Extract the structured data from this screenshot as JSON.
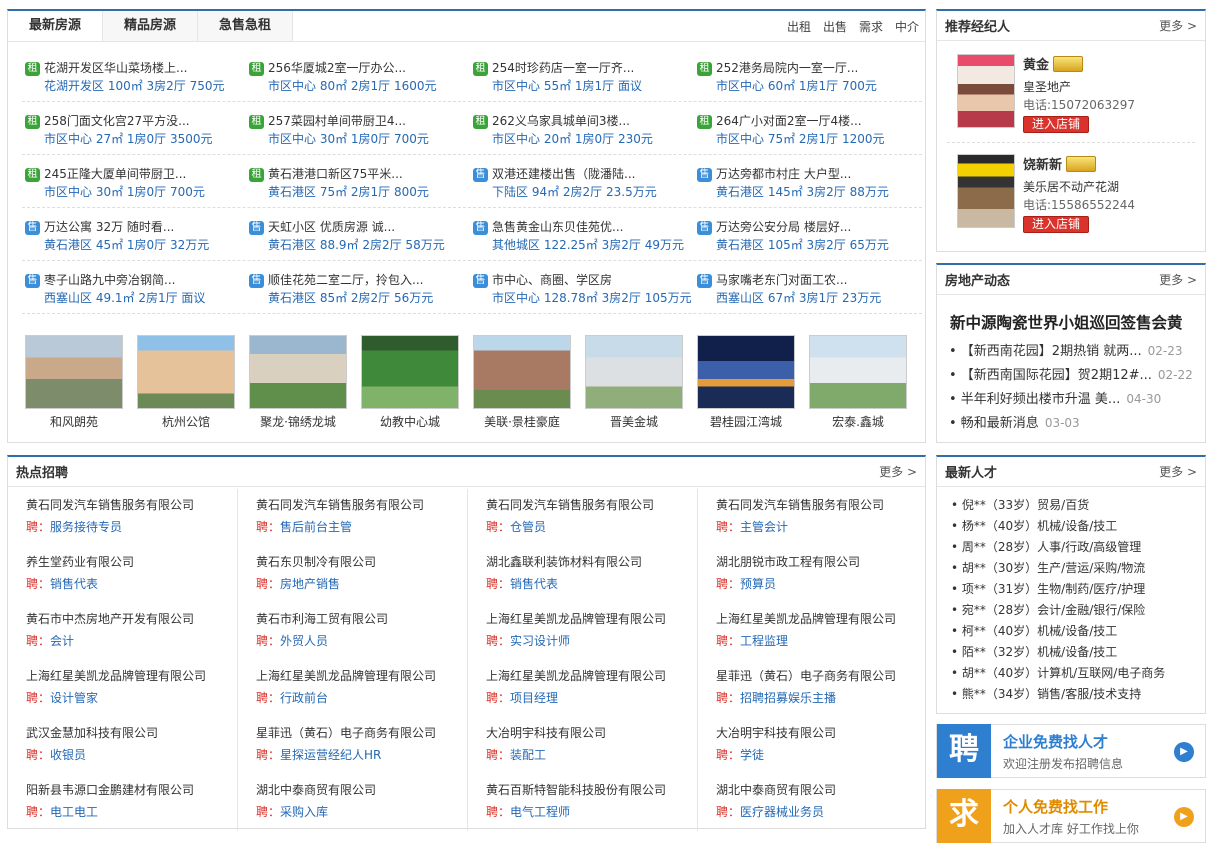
{
  "house": {
    "tabs": [
      "最新房源",
      "精品房源",
      "急售急租"
    ],
    "links": [
      "出租",
      "出售",
      "需求",
      "中介"
    ],
    "listings": [
      [
        {
          "type": "租",
          "title": "花湖开发区华山菜场楼上...",
          "detail": "花湖开发区 100㎡ 3房2厅 750元"
        },
        {
          "type": "租",
          "title": "256华厦城2室一厅办公...",
          "detail": "市区中心 80㎡ 2房1厅 1600元"
        },
        {
          "type": "租",
          "title": "254时珍药店一室一厅齐...",
          "detail": "市区中心 55㎡ 1房1厅 面议"
        },
        {
          "type": "租",
          "title": "252港务局院内一室一厅...",
          "detail": "市区中心 60㎡ 1房1厅 700元"
        }
      ],
      [
        {
          "type": "租",
          "title": "258门面文化宫27平方没...",
          "detail": "市区中心 27㎡ 1房0厅 3500元"
        },
        {
          "type": "租",
          "title": "257菜园村单间带厨卫4...",
          "detail": "市区中心 30㎡ 1房0厅 700元"
        },
        {
          "type": "租",
          "title": "262义乌家具城单间3楼...",
          "detail": "市区中心 20㎡ 1房0厅 230元"
        },
        {
          "type": "租",
          "title": "264广小对面2室一厅4楼...",
          "detail": "市区中心 75㎡ 2房1厅 1200元"
        }
      ],
      [
        {
          "type": "租",
          "title": "245正隆大厦单间带厨卫...",
          "detail": "市区中心 30㎡ 1房0厅 700元"
        },
        {
          "type": "租",
          "title": "黄石港港口新区75平米...",
          "detail": "黄石港区 75㎡ 2房1厅 800元"
        },
        {
          "type": "售",
          "title": "双港还建楼出售（陇潘陆...",
          "detail": "下陆区 94㎡ 2房2厅 23.5万元"
        },
        {
          "type": "售",
          "title": "万达旁都市村庄 大户型...",
          "detail": "黄石港区 145㎡ 3房2厅 88万元"
        }
      ],
      [
        {
          "type": "售",
          "title": "万达公寓 32万 随时看...",
          "detail": "黄石港区 45㎡ 1房0厅 32万元"
        },
        {
          "type": "售",
          "title": "天虹小区 优质房源 诚...",
          "detail": "黄石港区 88.9㎡ 2房2厅 58万元"
        },
        {
          "type": "售",
          "title": "急售黄金山东贝佳苑优...",
          "detail": "其他城区 122.25㎡ 3房2厅 49万元"
        },
        {
          "type": "售",
          "title": "万达旁公安分局 楼层好...",
          "detail": "黄石港区 105㎡ 3房2厅 65万元"
        }
      ],
      [
        {
          "type": "售",
          "title": "枣子山路九中旁冶钢简...",
          "detail": "西塞山区 49.1㎡ 2房1厅 面议"
        },
        {
          "type": "售",
          "title": "顺佳花苑二室二厅，拎包入...",
          "detail": "黄石港区 85㎡ 2房2厅 56万元"
        },
        {
          "type": "售",
          "title": "市中心、商圈、学区房",
          "detail": "市区中心 128.78㎡ 3房2厅 105万元"
        },
        {
          "type": "售",
          "title": "马家嘴老东门对面工农...",
          "detail": "西塞山区 67㎡ 3房1厅 23万元"
        }
      ]
    ],
    "photos": [
      "和风朗苑",
      "杭州公馆",
      "聚龙·锦绣龙城",
      "幼教中心城",
      "美联·景桂豪庭",
      "晋美金城",
      "碧桂园江湾城",
      "宏泰.鑫城"
    ]
  },
  "agents": {
    "title": "推荐经纪人",
    "more": "更多 >",
    "enter": "进入店铺",
    "list": [
      {
        "name": "黄金",
        "company": "皇圣地产",
        "tel": "电话:15072063297"
      },
      {
        "name": "饶新新",
        "company": "美乐居不动产花湖",
        "tel": "电话:15586552244"
      }
    ]
  },
  "news": {
    "title": "房地产动态",
    "more": "更多 >",
    "headline": "新中源陶瓷世界小姐巡回签售会黄",
    "items": [
      {
        "text": "• 【新西南花园】2期热销 就两...",
        "date": "02-23"
      },
      {
        "text": "• 【新西南国际花园】贺2期12#...",
        "date": "02-22"
      },
      {
        "text": "• 半年利好频出楼市升温 美...",
        "date": "04-30"
      },
      {
        "text": "• 畅和最新消息",
        "date": "03-03"
      }
    ]
  },
  "jobs": {
    "title": "热点招聘",
    "more": "更多 >",
    "prefix": "聘：",
    "columns": [
      [
        {
          "company": "黄石同发汽车销售服务有限公司",
          "position": "服务接待专员"
        },
        {
          "company": "养生堂药业有限公司",
          "position": "销售代表"
        },
        {
          "company": "黄石市中杰房地产开发有限公司",
          "position": "会计"
        },
        {
          "company": "上海红星美凯龙品牌管理有限公司",
          "position": "设计管家"
        },
        {
          "company": "武汉金慧加科技有限公司",
          "position": "收银员"
        },
        {
          "company": "阳新县韦源口金鹏建材有限公司",
          "position": "电工电工"
        }
      ],
      [
        {
          "company": "黄石同发汽车销售服务有限公司",
          "position": "售后前台主管"
        },
        {
          "company": "黄石东贝制冷有限公司",
          "position": "房地产销售"
        },
        {
          "company": "黄石市利海工贸有限公司",
          "position": "外贸人员"
        },
        {
          "company": "上海红星美凯龙品牌管理有限公司",
          "position": "行政前台"
        },
        {
          "company": "星菲迅（黄石）电子商务有限公司",
          "position": "星探运营经纪人HR"
        },
        {
          "company": "湖北中泰商贸有限公司",
          "position": "采购入库"
        }
      ],
      [
        {
          "company": "黄石同发汽车销售服务有限公司",
          "position": "仓管员"
        },
        {
          "company": "湖北鑫联利装饰材料有限公司",
          "position": "销售代表"
        },
        {
          "company": "上海红星美凯龙品牌管理有限公司",
          "position": "实习设计师"
        },
        {
          "company": "上海红星美凯龙品牌管理有限公司",
          "position": "项目经理"
        },
        {
          "company": "大冶明宇科技有限公司",
          "position": "装配工"
        },
        {
          "company": "黄石百斯特智能科技股份有限公司",
          "position": "电气工程师"
        }
      ],
      [
        {
          "company": "黄石同发汽车销售服务有限公司",
          "position": "主管会计"
        },
        {
          "company": "湖北朋锐市政工程有限公司",
          "position": "预算员"
        },
        {
          "company": "上海红星美凯龙品牌管理有限公司",
          "position": "工程监理"
        },
        {
          "company": "星菲迅（黄石）电子商务有限公司",
          "position": "招聘招募娱乐主播"
        },
        {
          "company": "大冶明宇科技有限公司",
          "position": "学徒"
        },
        {
          "company": "湖北中泰商贸有限公司",
          "position": "医疗器械业务员"
        }
      ]
    ]
  },
  "talent": {
    "title": "最新人才",
    "more": "更多 >",
    "items": [
      "• 倪**（33岁）贸易/百货",
      "• 杨**（40岁）机械/设备/技工",
      "• 周**（28岁）人事/行政/高级管理",
      "• 胡**（30岁）生产/营运/采购/物流",
      "• 项**（31岁）生物/制药/医疗/护理",
      "• 宛**（28岁）会计/金融/银行/保险",
      "• 柯**（40岁）机械/设备/技工",
      "• 陌**（32岁）机械/设备/技工",
      "• 胡**（40岁）计算机/互联网/电子商务",
      "• 熊**（34岁）销售/客服/技术支持"
    ]
  },
  "promos": [
    {
      "icon": "聘",
      "title": "企业免费找人才",
      "sub": "欢迎注册发布招聘信息",
      "color": "#2f7fd0"
    },
    {
      "icon": "求",
      "title": "个人免费找工作",
      "sub": "加入人才库 好工作找上你",
      "color": "#f0a11c"
    }
  ]
}
